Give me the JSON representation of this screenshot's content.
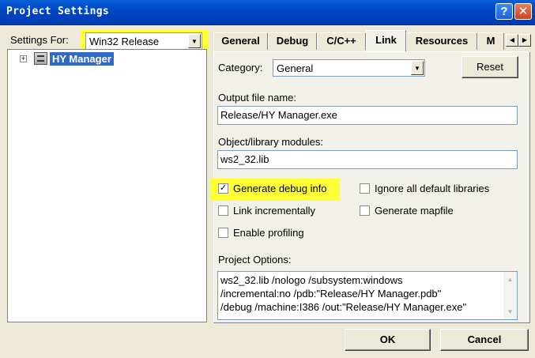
{
  "window": {
    "title": "Project Settings"
  },
  "left": {
    "settings_for_label": "Settings For:",
    "configuration": "Win32 Release",
    "tree": {
      "project": "HY Manager"
    }
  },
  "tabs": [
    {
      "label": "General"
    },
    {
      "label": "Debug"
    },
    {
      "label": "C/C++"
    },
    {
      "label": "Link",
      "active": true
    },
    {
      "label": "Resources"
    },
    {
      "label": "M"
    }
  ],
  "link": {
    "category_label": "Category:",
    "category_value": "General",
    "reset_label": "Reset",
    "output_label": "Output file name:",
    "output_value": "Release/HY Manager.exe",
    "modules_label": "Object/library modules:",
    "modules_value": "ws2_32.lib",
    "checkboxes": [
      {
        "label": "Generate debug info",
        "checked": true
      },
      {
        "label": "Ignore all default libraries",
        "checked": false
      },
      {
        "label": "Link incrementally",
        "checked": false
      },
      {
        "label": "Generate mapfile",
        "checked": false
      },
      {
        "label": "Enable profiling",
        "checked": false
      }
    ],
    "project_options_label": "Project Options:",
    "project_options_lines": [
      "ws2_32.lib /nologo /subsystem:windows",
      "/incremental:no /pdb:\"Release/HY Manager.pdb\"",
      "/debug /machine:I386 /out:\"Release/HY Manager.exe\""
    ]
  },
  "buttons": {
    "ok": "OK",
    "cancel": "Cancel"
  },
  "colors": {
    "highlight": "#ffff33",
    "selection": "#316ac5",
    "titlebar": "#0047c4"
  }
}
